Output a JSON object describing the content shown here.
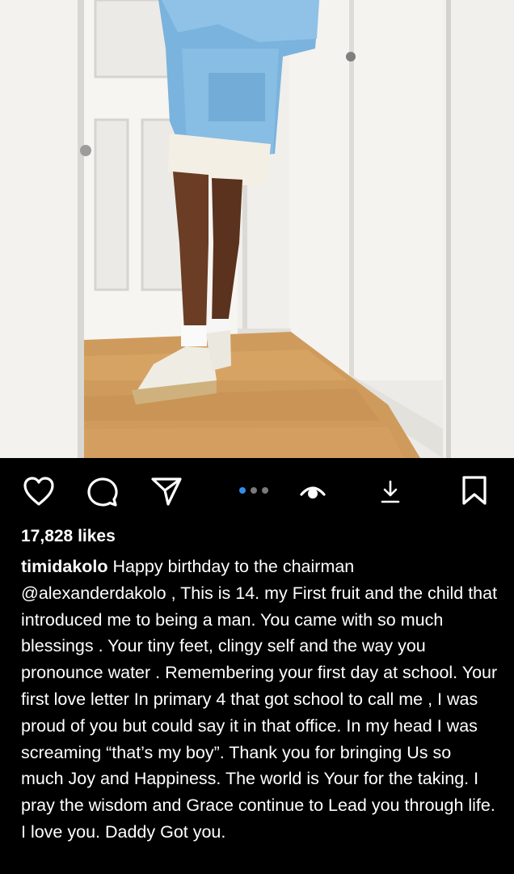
{
  "post": {
    "likes": "17,828 likes",
    "username": "timidakolo",
    "caption": " Happy birthday to the chairman @alexanderdakolo , This is 14. my First fruit and the child that  introduced me to being a man. You came with so much blessings . Your tiny feet, clingy self and the way you pronounce water . Remembering your first day at school. Your first love letter In primary 4 that got school to call me , I was proud of you but could say it in that office.  In my head I was screaming “that’s my boy”. Thank you for bringing Us so much Joy and Happiness. The world is Your for the taking. I pray the wisdom and Grace continue to Lead you through life.  I love you.  Daddy Got you."
  },
  "carousel": {
    "total": 3,
    "active_index": 0
  },
  "icons": {
    "like": "heart-icon",
    "comment": "comment-bubble-icon",
    "share": "paper-plane-icon",
    "view": "eye-icon",
    "download": "download-icon",
    "save": "bookmark-icon"
  },
  "colors": {
    "background": "#000000",
    "text": "#ffffff",
    "carousel_active": "#2f8fed",
    "carousel_inactive": "#7a7a7a"
  }
}
